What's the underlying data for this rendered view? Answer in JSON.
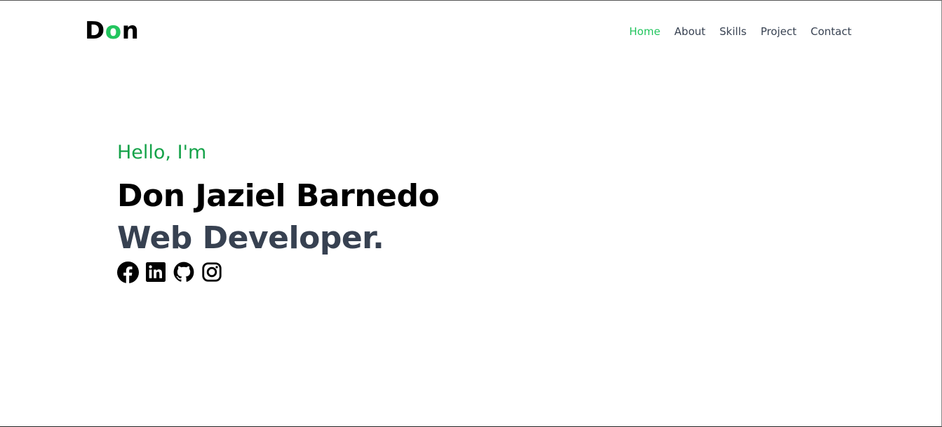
{
  "navbar": {
    "logo": {
      "first": "D",
      "accent": "o",
      "last": "n",
      "accent_color": "#22c55e"
    },
    "links": [
      {
        "label": "Home",
        "active": true
      },
      {
        "label": "About",
        "active": false
      },
      {
        "label": "Skills",
        "active": false
      },
      {
        "label": "Project",
        "active": false
      },
      {
        "label": "Contact",
        "active": false
      }
    ]
  },
  "hero": {
    "greeting": "Hello, I'm",
    "name": "Don Jaziel Barnedo",
    "role": "Web Developer.",
    "greeting_color": "#16a34a",
    "role_color": "#374151"
  },
  "socials": [
    {
      "icon": "facebook-icon"
    },
    {
      "icon": "linkedin-icon"
    },
    {
      "icon": "github-icon"
    },
    {
      "icon": "instagram-icon"
    }
  ]
}
